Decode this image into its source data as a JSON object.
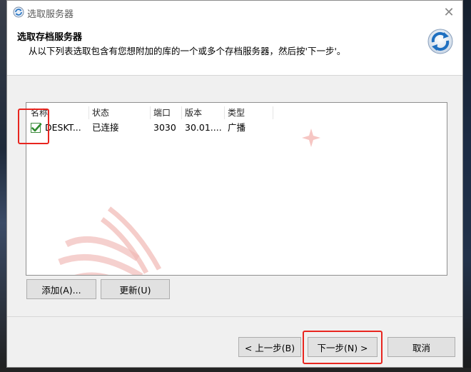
{
  "window": {
    "title": "选取服务器",
    "close_glyph": "✕"
  },
  "header": {
    "title": "选取存档服务器",
    "description": "从以下列表选取包含有您想附加的库的一个或多个存档服务器，然后按'下一步'。"
  },
  "table": {
    "columns": [
      "名称",
      "状态",
      "端口",
      "版本",
      "类型"
    ],
    "rows": [
      {
        "checked": true,
        "name": "DESKT...",
        "status": "已连接",
        "port": "3030",
        "version": "30.01....",
        "type": "广播"
      }
    ]
  },
  "list_buttons": {
    "add": "添加(A)...",
    "refresh": "更新(U)"
  },
  "footer_buttons": {
    "back": "< 上一步(B)",
    "next": "下一步(N) >",
    "cancel": "取消"
  },
  "colors": {
    "annotation_red": "#e8251f",
    "check_green": "#2e8b2e",
    "icon_blue": "#1e6fc0"
  }
}
